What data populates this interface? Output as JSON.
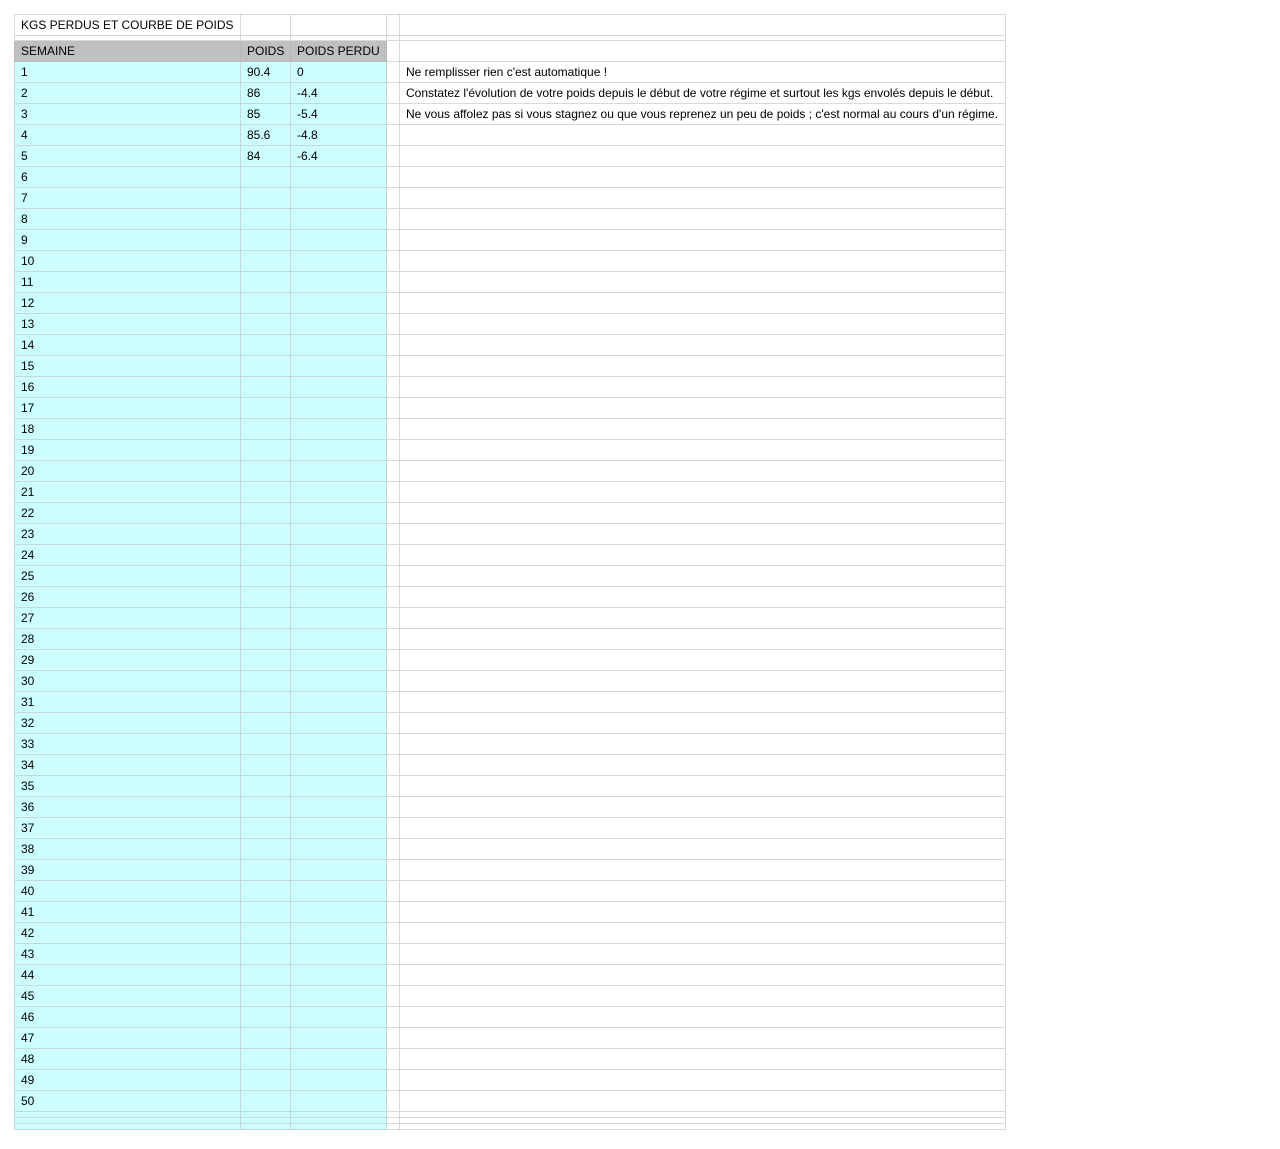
{
  "title": "KGS PERDUS ET COURBE DE POIDS",
  "headers": {
    "semaine": "SEMAINE",
    "poids": "POIDS",
    "poids_perdu": "POIDS PERDU"
  },
  "rows": [
    {
      "semaine": "1",
      "poids": "90.4",
      "perdu": "0",
      "note": "Ne remplisser rien c'est automatique !"
    },
    {
      "semaine": "2",
      "poids": "86",
      "perdu": "-4.4",
      "note": "Constatez l'évolution de votre poids depuis le début de votre régime et surtout les kgs envolés depuis le début."
    },
    {
      "semaine": "3",
      "poids": "85",
      "perdu": "-5.4",
      "note": "Ne vous affolez pas si vous stagnez ou que vous reprenez un peu de poids ; c'est normal au cours d'un régime."
    },
    {
      "semaine": "4",
      "poids": "85.6",
      "perdu": "-4.8",
      "note": ""
    },
    {
      "semaine": "5",
      "poids": "84",
      "perdu": "-6.4",
      "note": ""
    },
    {
      "semaine": "6",
      "poids": "",
      "perdu": "",
      "note": ""
    },
    {
      "semaine": "7",
      "poids": "",
      "perdu": "",
      "note": ""
    },
    {
      "semaine": "8",
      "poids": "",
      "perdu": "",
      "note": ""
    },
    {
      "semaine": "9",
      "poids": "",
      "perdu": "",
      "note": ""
    },
    {
      "semaine": "10",
      "poids": "",
      "perdu": "",
      "note": ""
    },
    {
      "semaine": "11",
      "poids": "",
      "perdu": "",
      "note": ""
    },
    {
      "semaine": "12",
      "poids": "",
      "perdu": "",
      "note": ""
    },
    {
      "semaine": "13",
      "poids": "",
      "perdu": "",
      "note": ""
    },
    {
      "semaine": "14",
      "poids": "",
      "perdu": "",
      "note": ""
    },
    {
      "semaine": "15",
      "poids": "",
      "perdu": "",
      "note": ""
    },
    {
      "semaine": "16",
      "poids": "",
      "perdu": "",
      "note": ""
    },
    {
      "semaine": "17",
      "poids": "",
      "perdu": "",
      "note": ""
    },
    {
      "semaine": "18",
      "poids": "",
      "perdu": "",
      "note": ""
    },
    {
      "semaine": "19",
      "poids": "",
      "perdu": "",
      "note": ""
    },
    {
      "semaine": "20",
      "poids": "",
      "perdu": "",
      "note": ""
    },
    {
      "semaine": "21",
      "poids": "",
      "perdu": "",
      "note": ""
    },
    {
      "semaine": "22",
      "poids": "",
      "perdu": "",
      "note": ""
    },
    {
      "semaine": "23",
      "poids": "",
      "perdu": "",
      "note": ""
    },
    {
      "semaine": "24",
      "poids": "",
      "perdu": "",
      "note": ""
    },
    {
      "semaine": "25",
      "poids": "",
      "perdu": "",
      "note": ""
    },
    {
      "semaine": "26",
      "poids": "",
      "perdu": "",
      "note": ""
    },
    {
      "semaine": "27",
      "poids": "",
      "perdu": "",
      "note": ""
    },
    {
      "semaine": "28",
      "poids": "",
      "perdu": "",
      "note": ""
    },
    {
      "semaine": "29",
      "poids": "",
      "perdu": "",
      "note": ""
    },
    {
      "semaine": "30",
      "poids": "",
      "perdu": "",
      "note": ""
    },
    {
      "semaine": "31",
      "poids": "",
      "perdu": "",
      "note": ""
    },
    {
      "semaine": "32",
      "poids": "",
      "perdu": "",
      "note": ""
    },
    {
      "semaine": "33",
      "poids": "",
      "perdu": "",
      "note": ""
    },
    {
      "semaine": "34",
      "poids": "",
      "perdu": "",
      "note": ""
    },
    {
      "semaine": "35",
      "poids": "",
      "perdu": "",
      "note": ""
    },
    {
      "semaine": "36",
      "poids": "",
      "perdu": "",
      "note": ""
    },
    {
      "semaine": "37",
      "poids": "",
      "perdu": "",
      "note": ""
    },
    {
      "semaine": "38",
      "poids": "",
      "perdu": "",
      "note": ""
    },
    {
      "semaine": "39",
      "poids": "",
      "perdu": "",
      "note": ""
    },
    {
      "semaine": "40",
      "poids": "",
      "perdu": "",
      "note": ""
    },
    {
      "semaine": "41",
      "poids": "",
      "perdu": "",
      "note": ""
    },
    {
      "semaine": "42",
      "poids": "",
      "perdu": "",
      "note": ""
    },
    {
      "semaine": "43",
      "poids": "",
      "perdu": "",
      "note": ""
    },
    {
      "semaine": "44",
      "poids": "",
      "perdu": "",
      "note": ""
    },
    {
      "semaine": "45",
      "poids": "",
      "perdu": "",
      "note": ""
    },
    {
      "semaine": "46",
      "poids": "",
      "perdu": "",
      "note": ""
    },
    {
      "semaine": "47",
      "poids": "",
      "perdu": "",
      "note": ""
    },
    {
      "semaine": "48",
      "poids": "",
      "perdu": "",
      "note": ""
    },
    {
      "semaine": "49",
      "poids": "",
      "perdu": "",
      "note": ""
    },
    {
      "semaine": "50",
      "poids": "",
      "perdu": "",
      "note": ""
    }
  ],
  "colors": {
    "data_fill": "#ccffff",
    "header_fill": "#c0c0c0",
    "gridline": "#d9d9d9"
  }
}
